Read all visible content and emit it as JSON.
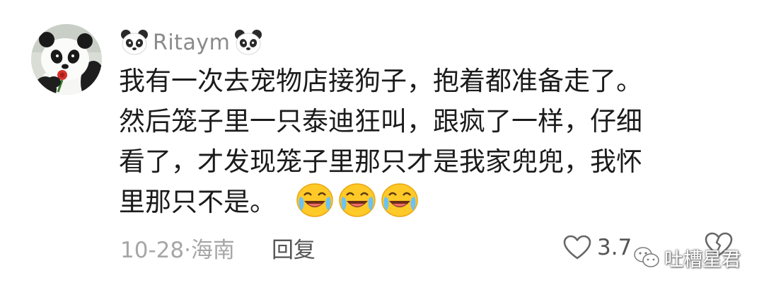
{
  "comment": {
    "username": "Ritaym",
    "username_decoration": "panda-emoji",
    "body_lines": [
      "我有一次去宠物店接狗子，抱着都准备走了。",
      "然后笼子里一只泰迪狂叫，跟疯了一样，仔细",
      "看了，才发现笼子里那只才是我家兜兜，我怀",
      "里那只不是。"
    ],
    "trailing_emojis": [
      "laugh-cry-emoji",
      "laugh-cry-emoji",
      "laugh-cry-emoji"
    ],
    "meta": "10-28·海南",
    "reply_label": "回复",
    "like_count": "3.7",
    "icons": {
      "like": "heart-outline-icon",
      "dislike": "broken-heart-icon"
    }
  },
  "watermark": {
    "text": "吐槽星君",
    "icon": "wechat-icon"
  },
  "colors": {
    "username": "#8a8a8a",
    "body": "#1b1b1b",
    "meta": "#a6a6a6",
    "action": "#555555",
    "emoji_yellow": "#ffc928"
  }
}
